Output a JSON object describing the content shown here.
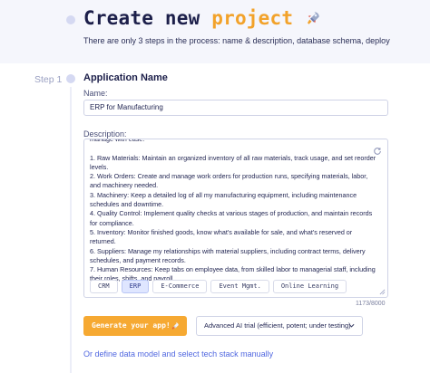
{
  "header": {
    "title_main": "Create new ",
    "title_accent": "project",
    "title_icon": "rocket-icon",
    "subtitle": "There are only 3 steps in the process: name & description, database schema, deploy"
  },
  "step": {
    "label": "Step 1",
    "section_title": "Application Name"
  },
  "form": {
    "name_label": "Name:",
    "name_value": "ERP for Manufacturing",
    "description_label": "Description:",
    "description_value": "manage with ease:\n\n1. Raw Materials: Maintain an organized inventory of all raw materials, track usage, and set reorder levels.\n2. Work Orders: Create and manage work orders for production runs, specifying materials, labor, and machinery needed.\n3. Machinery: Keep a detailed log of all my manufacturing equipment, including maintenance schedules and downtime.\n4. Quality Control: Implement quality checks at various stages of production, and maintain records for compliance.\n5. Inventory: Monitor finished goods, know what's available for sale, and what's reserved or returned.\n6. Suppliers: Manage my relationships with material suppliers, including contract terms, delivery schedules, and payment records.\n7. Human Resources: Keep tabs on employee data, from skilled labor to managerial staff, including their roles, shifts, and payroll.",
    "char_count": "1173/8000",
    "templates": [
      {
        "label": "CRM",
        "active": false
      },
      {
        "label": "ERP",
        "active": true
      },
      {
        "label": "E-Commerce",
        "active": false
      },
      {
        "label": "Event Mgmt.",
        "active": false
      },
      {
        "label": "Online Learning",
        "active": false
      }
    ]
  },
  "actions": {
    "generate_label": "Generate your app!",
    "generate_icon": "rocket-icon",
    "model_selected": "Advanced AI trial (efficient, potent; under testing)",
    "manual_link": "Or define data model and select tech stack manually"
  },
  "colors": {
    "accent_orange": "#f6a932",
    "link_blue": "#5067e0",
    "title_navy": "#1c1f4a"
  }
}
